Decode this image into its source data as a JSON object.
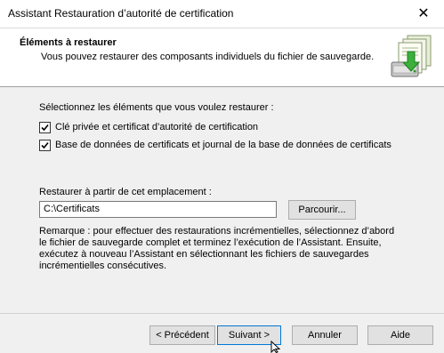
{
  "window": {
    "title": "Assistant Restauration d’autorité de certification",
    "close_glyph": "✕"
  },
  "header": {
    "title": "Éléments à restaurer",
    "subtitle": "Vous pouvez restaurer des composants individuels du fichier de sauvegarde.",
    "icon": "certificate-restore-icon"
  },
  "body": {
    "prompt": "Sélectionnez les éléments que vous voulez restaurer :",
    "items": [
      {
        "label": "Clé privée et certificat d’autorité de certification",
        "checked": true
      },
      {
        "label": "Base de données de certificats et journal de la base de données de certificats",
        "checked": true
      }
    ],
    "location_label": "Restaurer à partir de cet emplacement :",
    "location_value": "C:\\Certificats",
    "browse_label": "Parcourir...",
    "note": "Remarque : pour effectuer des restaurations incrémentielles, sélectionnez d’abord le fichier de sauvegarde complet et terminez l’exécution de l’Assistant. Ensuite, exécutez à nouveau l’Assistant en sélectionnant les fichiers de sauvegardes incrémentielles consécutives."
  },
  "footer": {
    "prev_label": "< Précédent",
    "next_label": "Suivant >",
    "cancel_label": "Annuler",
    "help_label": "Aide"
  },
  "colors": {
    "focus": "#0078d7",
    "button_face": "#e1e1e1",
    "dialog_bg": "#f0f0f0"
  }
}
